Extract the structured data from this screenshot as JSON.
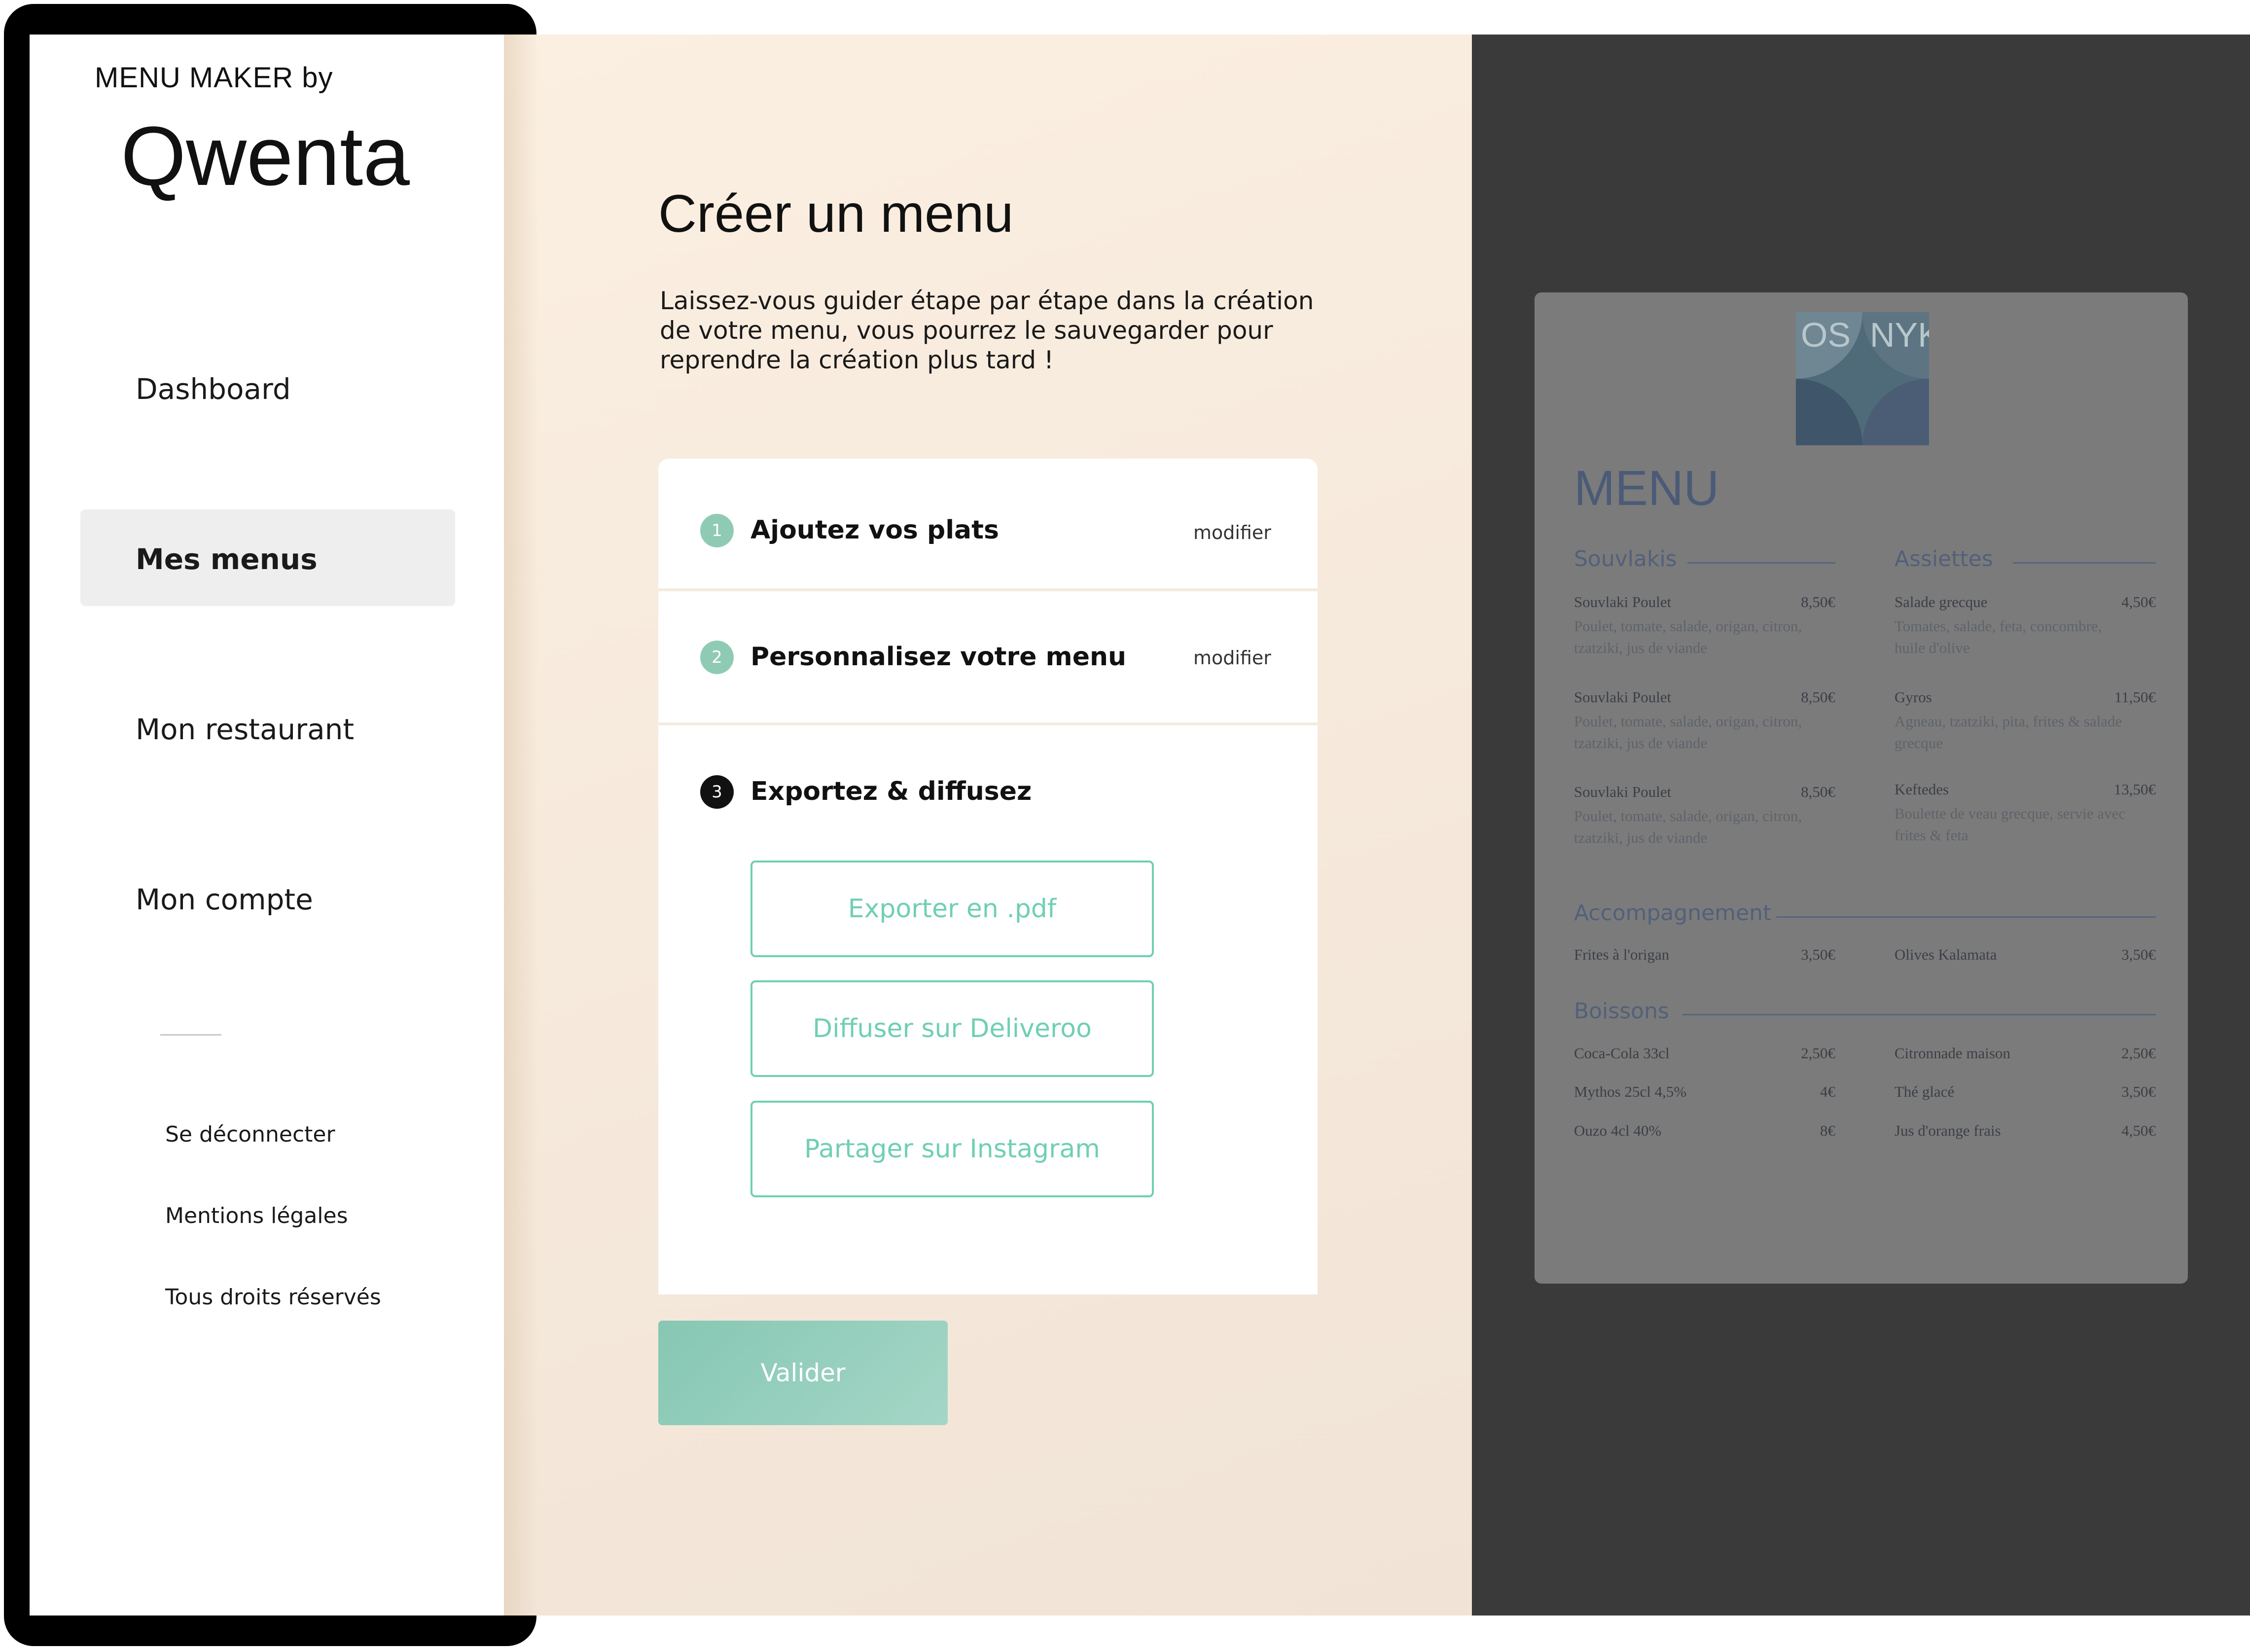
{
  "brand": {
    "prefix": "MENU MAKER by",
    "logo_text": "Qwenta"
  },
  "nav": {
    "items": [
      {
        "label": "Dashboard"
      },
      {
        "label": "Mes menus"
      },
      {
        "label": "Mon restaurant"
      },
      {
        "label": "Mon compte"
      }
    ],
    "active": "Mes menus",
    "footer": [
      {
        "label": "Se déconnecter"
      },
      {
        "label": "Mentions légales"
      },
      {
        "label": "Tous droits réservés"
      }
    ]
  },
  "main": {
    "title": "Créer un menu",
    "description": "Laissez-vous guider étape par étape dans la création de votre menu, vous pourrez le sauvegarder pour reprendre la création plus tard !",
    "steps": [
      {
        "number": "1",
        "title": "Ajoutez vos plats",
        "edit_label": "modifier",
        "status": "done"
      },
      {
        "number": "2",
        "title": "Personnalisez votre menu",
        "edit_label": "modifier",
        "status": "done"
      },
      {
        "number": "3",
        "title": "Exportez & diffusez",
        "status": "current"
      }
    ],
    "export_buttons": [
      {
        "label": "Exporter en .pdf"
      },
      {
        "label": "Diffuser sur Deliveroo"
      },
      {
        "label": "Partager sur Instagram"
      }
    ],
    "submit_label": "Valider"
  },
  "preview": {
    "logo_text_left": "OS",
    "logo_text_right": "NYK",
    "heading": "MENU",
    "sections": [
      {
        "name": "Souvlakis",
        "items": [
          {
            "name": "Souvlaki Poulet",
            "price": "8,50€",
            "desc": "Poulet, tomate, salade, origan, citron, tzatziki, jus de viande"
          },
          {
            "name": "Souvlaki Poulet",
            "price": "8,50€",
            "desc": "Poulet, tomate, salade, origan, citron, tzatziki, jus de viande"
          },
          {
            "name": "Souvlaki Poulet",
            "price": "8,50€",
            "desc": "Poulet, tomate, salade, origan, citron, tzatziki, jus de viande"
          }
        ]
      },
      {
        "name": "Assiettes",
        "items": [
          {
            "name": "Salade grecque",
            "price": "4,50€",
            "desc": "Tomates, salade, feta, concombre, huile d'olive"
          },
          {
            "name": "Gyros",
            "price": "11,50€",
            "desc": "Agneau, tzatziki, pita, frites & salade grecque"
          },
          {
            "name": "Keftedes",
            "price": "13,50€",
            "desc": "Boulette de veau grecque, servie avec frites & feta"
          }
        ]
      },
      {
        "name": "Accompagnement",
        "items": [
          {
            "name": "Frites à l'origan",
            "price": "3,50€"
          },
          {
            "name": "Olives Kalamata",
            "price": "3,50€"
          }
        ]
      },
      {
        "name": "Boissons",
        "items": [
          {
            "name": "Coca-Cola 33cl",
            "price": "2,50€"
          },
          {
            "name": "Citronnade maison",
            "price": "2,50€"
          },
          {
            "name": "Mythos 25cl 4,5%",
            "price": "4€"
          },
          {
            "name": "Thé glacé",
            "price": "3,50€"
          },
          {
            "name": "Ouzo 4cl 40%",
            "price": "8€"
          },
          {
            "name": "Jus d'orange frais",
            "price": "4,50€"
          }
        ]
      }
    ]
  },
  "colors": {
    "accent": "#6fcfb4",
    "accent_muted": "#8fcbb4",
    "main_bg": "#f5e9dc",
    "preview_bg": "#3a3a3a"
  }
}
